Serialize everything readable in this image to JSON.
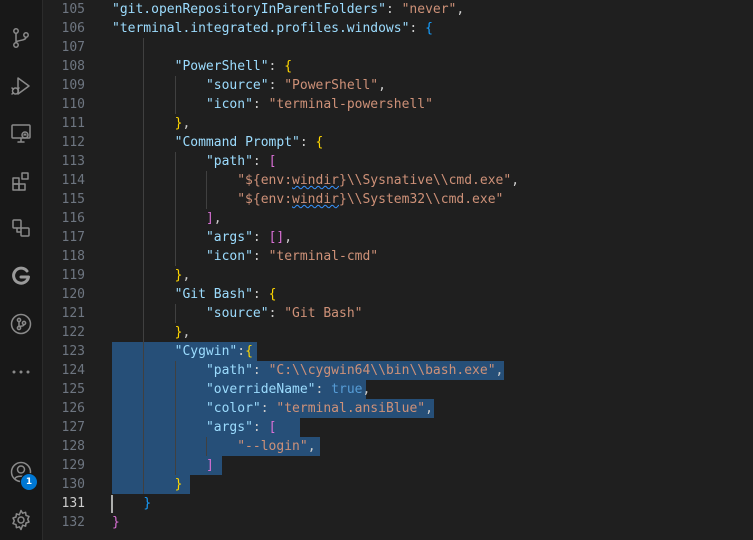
{
  "activity_bar": {
    "account_badge": "1"
  },
  "editor": {
    "active_line": "131",
    "lines": [
      {
        "num": "105",
        "tokens": [
          [
            "k",
            "\"git.openRepositoryInParentFolders\""
          ],
          [
            "p",
            ": "
          ],
          [
            "s",
            "\"never\""
          ],
          [
            "p",
            ","
          ]
        ]
      },
      {
        "num": "106",
        "tokens": [
          [
            "k",
            "\"terminal.integrated.profiles.windows\""
          ],
          [
            "p",
            ": "
          ],
          [
            "b3",
            "{"
          ]
        ]
      },
      {
        "num": "107",
        "tokens": []
      },
      {
        "num": "108",
        "tokens": [
          [
            "p",
            "    "
          ],
          [
            "k",
            "\"PowerShell\""
          ],
          [
            "p",
            ": "
          ],
          [
            "b1",
            "{"
          ]
        ]
      },
      {
        "num": "109",
        "tokens": [
          [
            "p",
            "        "
          ],
          [
            "k",
            "\"source\""
          ],
          [
            "p",
            ": "
          ],
          [
            "s",
            "\"PowerShell\""
          ],
          [
            "p",
            ","
          ]
        ]
      },
      {
        "num": "110",
        "tokens": [
          [
            "p",
            "        "
          ],
          [
            "k",
            "\"icon\""
          ],
          [
            "p",
            ": "
          ],
          [
            "s",
            "\"terminal-powershell\""
          ]
        ]
      },
      {
        "num": "111",
        "tokens": [
          [
            "p",
            "    "
          ],
          [
            "b1",
            "}"
          ],
          [
            "p",
            ","
          ]
        ]
      },
      {
        "num": "112",
        "tokens": [
          [
            "p",
            "    "
          ],
          [
            "k",
            "\"Command Prompt\""
          ],
          [
            "p",
            ": "
          ],
          [
            "b1",
            "{"
          ]
        ]
      },
      {
        "num": "113",
        "tokens": [
          [
            "p",
            "        "
          ],
          [
            "k",
            "\"path\""
          ],
          [
            "p",
            ": "
          ],
          [
            "b2",
            "["
          ]
        ]
      },
      {
        "num": "114",
        "tokens": [
          [
            "p",
            "            "
          ],
          [
            "s",
            "\"${env:"
          ],
          [
            "sq",
            "windir"
          ],
          [
            "s",
            "}\\\\Sysnative\\\\cmd.exe\""
          ],
          [
            "p",
            ","
          ]
        ]
      },
      {
        "num": "115",
        "tokens": [
          [
            "p",
            "            "
          ],
          [
            "s",
            "\"${env:"
          ],
          [
            "sq",
            "windir"
          ],
          [
            "s",
            "}\\\\System32\\\\cmd.exe\""
          ]
        ]
      },
      {
        "num": "116",
        "tokens": [
          [
            "p",
            "        "
          ],
          [
            "b2",
            "]"
          ],
          [
            "p",
            ","
          ]
        ]
      },
      {
        "num": "117",
        "tokens": [
          [
            "p",
            "        "
          ],
          [
            "k",
            "\"args\""
          ],
          [
            "p",
            ": "
          ],
          [
            "b2",
            "[]"
          ],
          [
            "p",
            ","
          ]
        ]
      },
      {
        "num": "118",
        "tokens": [
          [
            "p",
            "        "
          ],
          [
            "k",
            "\"icon\""
          ],
          [
            "p",
            ": "
          ],
          [
            "s",
            "\"terminal-cmd\""
          ]
        ]
      },
      {
        "num": "119",
        "tokens": [
          [
            "p",
            "    "
          ],
          [
            "b1",
            "}"
          ],
          [
            "p",
            ","
          ]
        ]
      },
      {
        "num": "120",
        "tokens": [
          [
            "p",
            "    "
          ],
          [
            "k",
            "\"Git Bash\""
          ],
          [
            "p",
            ": "
          ],
          [
            "b1",
            "{"
          ]
        ]
      },
      {
        "num": "121",
        "tokens": [
          [
            "p",
            "        "
          ],
          [
            "k",
            "\"source\""
          ],
          [
            "p",
            ": "
          ],
          [
            "s",
            "\"Git Bash\""
          ]
        ]
      },
      {
        "num": "122",
        "tokens": [
          [
            "p",
            "    "
          ],
          [
            "b1",
            "}"
          ],
          [
            "p",
            ","
          ]
        ]
      },
      {
        "num": "123",
        "tokens": [
          [
            "p",
            "    "
          ],
          [
            "k",
            "\"Cygwin\""
          ],
          [
            "p",
            ":"
          ],
          [
            "b1",
            "{"
          ]
        ]
      },
      {
        "num": "124",
        "tokens": [
          [
            "p",
            "        "
          ],
          [
            "k",
            "\"path\""
          ],
          [
            "p",
            ": "
          ],
          [
            "s",
            "\"C:\\\\cygwin64\\\\bin\\\\bash.exe\""
          ],
          [
            "p",
            ","
          ]
        ]
      },
      {
        "num": "125",
        "tokens": [
          [
            "p",
            "        "
          ],
          [
            "k",
            "\"overrideName\""
          ],
          [
            "p",
            ": "
          ],
          [
            "kw",
            "true"
          ],
          [
            "p",
            ","
          ]
        ]
      },
      {
        "num": "126",
        "tokens": [
          [
            "p",
            "        "
          ],
          [
            "k",
            "\"color\""
          ],
          [
            "p",
            ": "
          ],
          [
            "s",
            "\"terminal.ansiBlue\""
          ],
          [
            "p",
            ","
          ]
        ]
      },
      {
        "num": "127",
        "tokens": [
          [
            "p",
            "        "
          ],
          [
            "k",
            "\"args\""
          ],
          [
            "p",
            ": "
          ],
          [
            "b2",
            "["
          ]
        ]
      },
      {
        "num": "128",
        "tokens": [
          [
            "p",
            "            "
          ],
          [
            "s",
            "\"--login\""
          ],
          [
            "p",
            ","
          ]
        ]
      },
      {
        "num": "129",
        "tokens": [
          [
            "p",
            "        "
          ],
          [
            "b2",
            "]"
          ]
        ]
      },
      {
        "num": "130",
        "tokens": [
          [
            "p",
            "    "
          ],
          [
            "b1",
            "}"
          ]
        ]
      },
      {
        "num": "131",
        "tokens": [
          [
            "b3",
            "}"
          ]
        ]
      },
      {
        "num": "132",
        "tokens": [
          [
            "b2",
            "}"
          ]
        ]
      }
    ]
  }
}
